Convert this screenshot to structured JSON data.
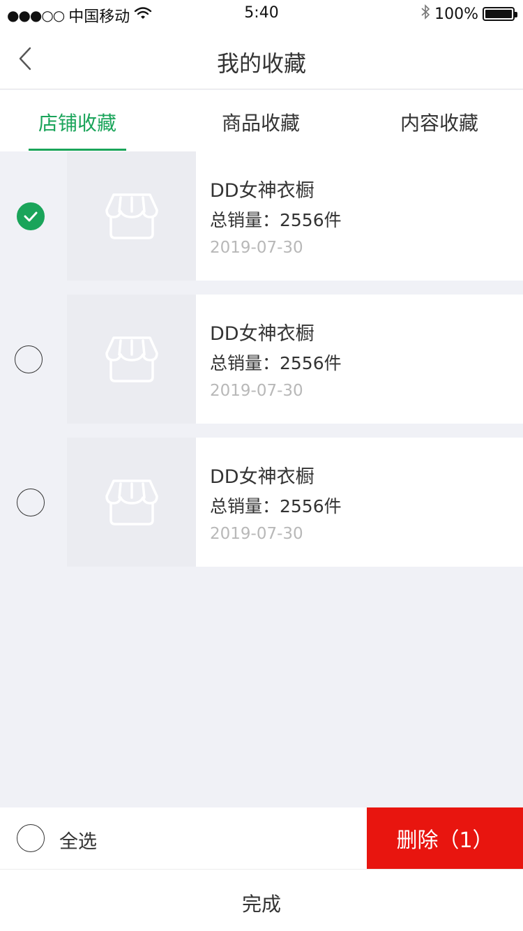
{
  "status_bar": {
    "signal": "●●●○○",
    "carrier": "中国移动",
    "wifi_icon": "wifi-icon",
    "time": "5:40",
    "bluetooth_icon": "bluetooth-icon",
    "battery_percent": "100%",
    "battery_level": 1.0
  },
  "nav": {
    "title": "我的收藏",
    "back_icon": "chevron-left-icon"
  },
  "tabs": [
    {
      "label": "店铺收藏",
      "active": true
    },
    {
      "label": "商品收藏",
      "active": false
    },
    {
      "label": "内容收藏",
      "active": false
    }
  ],
  "shops": [
    {
      "name": "DD女神衣橱",
      "sales": "总销量：2556件",
      "date": "2019-07-30",
      "selected": true,
      "icon": "store-icon"
    },
    {
      "name": "DD女神衣橱",
      "sales": "总销量：2556件",
      "date": "2019-07-30",
      "selected": false,
      "icon": "store-icon"
    },
    {
      "name": "DD女神衣橱",
      "sales": "总销量：2556件",
      "date": "2019-07-30",
      "selected": false,
      "icon": "store-icon"
    }
  ],
  "bottom": {
    "select_all_label": "全选",
    "delete_label": "删除（1）"
  },
  "done_label": "完成",
  "colors": {
    "accent": "#1aa45a",
    "danger": "#e8150f",
    "background": "#f0f1f6"
  }
}
